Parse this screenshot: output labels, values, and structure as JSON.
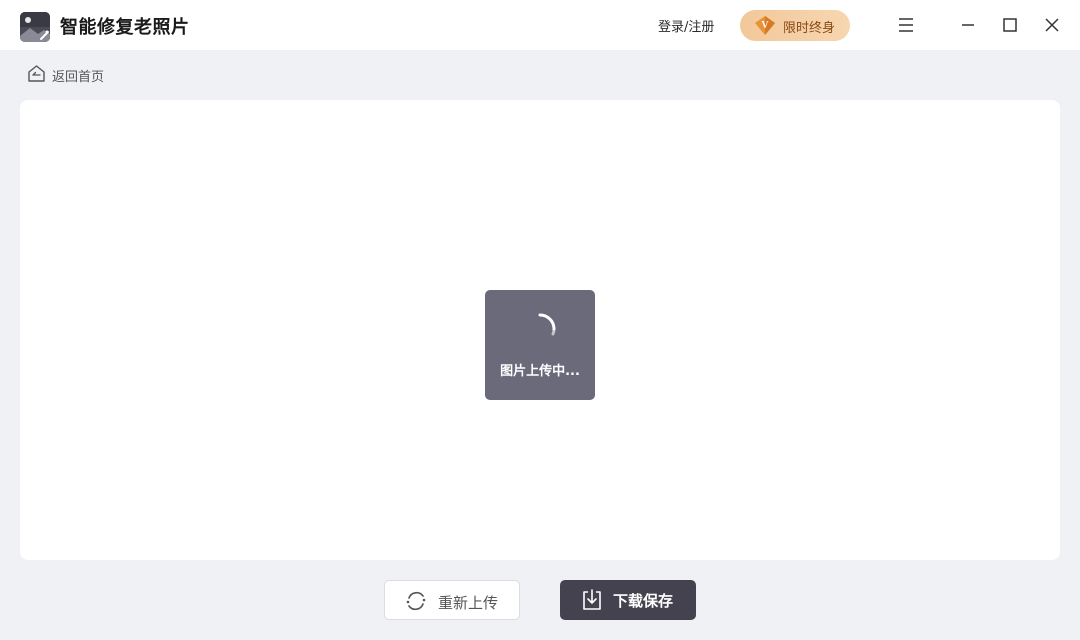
{
  "app": {
    "title": "智能修复老照片",
    "logo_icon": "photo-magic-icon"
  },
  "header": {
    "login_label": "登录/注册",
    "vip_label": "限时终身",
    "vip_icon": "vip-diamond-icon",
    "menu_icon": "hamburger-menu-icon",
    "minimize_icon": "minimize-icon",
    "maximize_icon": "maximize-icon",
    "close_icon": "close-icon"
  },
  "nav": {
    "back_home_label": "返回首页",
    "back_home_icon": "home-back-icon"
  },
  "main": {
    "loading_text": "图片上传中..."
  },
  "actions": {
    "reupload_label": "重新上传",
    "reupload_icon": "refresh-icon",
    "download_label": "下载保存",
    "download_icon": "download-icon"
  },
  "colors": {
    "accent_dark": "#45424f",
    "vip_gold": "#f2c89a",
    "loading_bg": "#6b6a7a",
    "page_bg": "#f0f1f5"
  }
}
